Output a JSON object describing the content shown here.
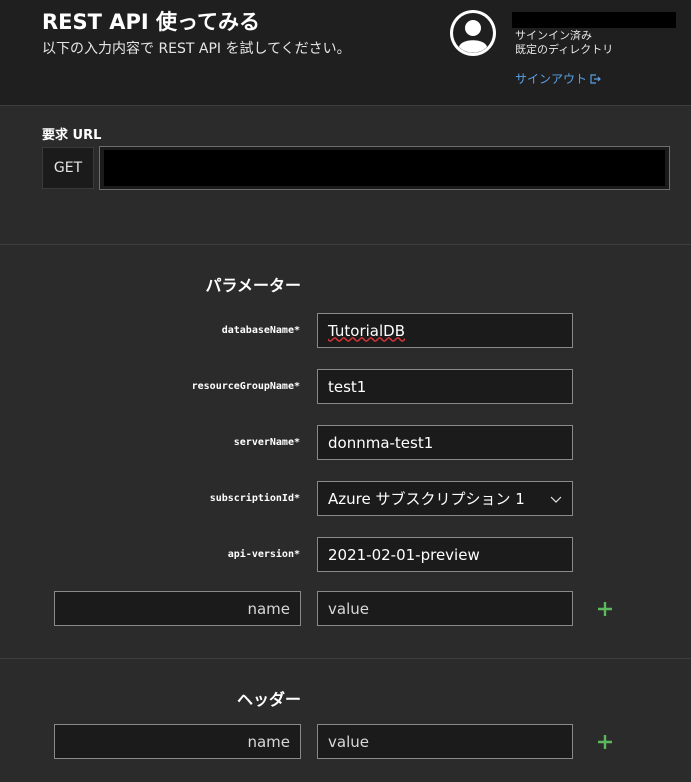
{
  "header": {
    "title": "REST API 使ってみる",
    "subtitle": "以下の入力内容で REST API を試してください。",
    "account": {
      "status": "サインイン済み",
      "directory": "既定のディレクトリ",
      "signout_label": "サインアウト"
    }
  },
  "request": {
    "label": "要求 URL",
    "method": "GET"
  },
  "parameters": {
    "title": "パラメーター",
    "fields": [
      {
        "label": "databaseName*",
        "value": "TutorialDB"
      },
      {
        "label": "resourceGroupName*",
        "value": "test1"
      },
      {
        "label": "serverName*",
        "value": "donnma-test1"
      },
      {
        "label": "subscriptionId*",
        "value": "Azure サブスクリプション 1"
      },
      {
        "label": "api-version*",
        "value": "2021-02-01-preview"
      }
    ],
    "new_row": {
      "name_placeholder": "name",
      "value_placeholder": "value"
    }
  },
  "headers": {
    "title": "ヘッダー",
    "new_row": {
      "name_placeholder": "name",
      "value_placeholder": "value"
    }
  },
  "colors": {
    "accent_link": "#5aa0e6",
    "add_icon": "#5cb85c",
    "spell_error": "#d13438"
  },
  "icons": {
    "avatar": "user-avatar-icon",
    "signout": "sign-out-icon",
    "dropdown": "chevron-down-icon",
    "add": "plus-icon"
  }
}
